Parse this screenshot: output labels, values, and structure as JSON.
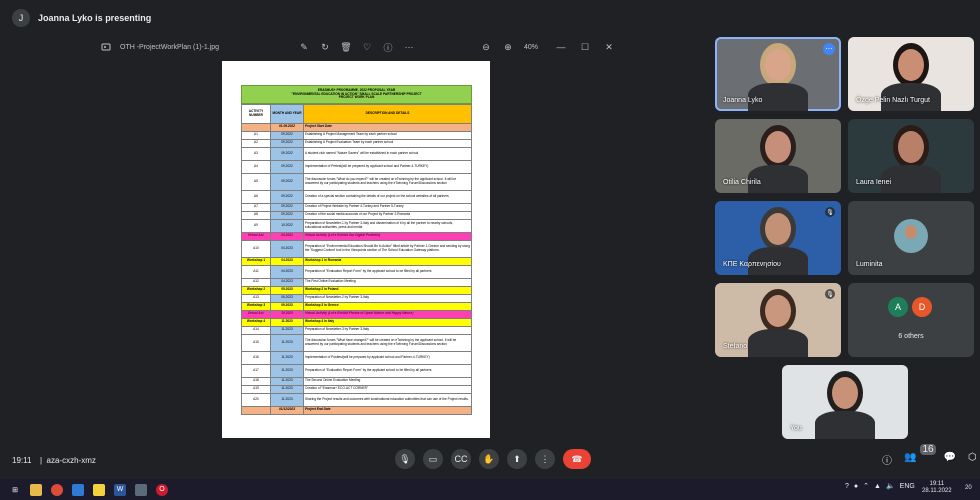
{
  "header": {
    "avatar_letter": "J",
    "presenting_text": "Joanna Lyko is presenting"
  },
  "viewer": {
    "file_name": "OTH -ProjectWorkPlan (1)-1.jpg",
    "zoom_level": "40%",
    "icons": [
      "edit-icon",
      "rotate-icon",
      "delete-icon",
      "favorite-icon",
      "info-icon",
      "more-icon",
      "zoom-out-icon",
      "zoom-in-icon",
      "minimize-icon",
      "maximize-icon",
      "close-icon"
    ]
  },
  "document": {
    "title_lines": [
      "ERASMUS+ PROGRAMME, 2022 PROPOSAL YEAR",
      "\"ENVIRONMENTAL EDUCATION IN ACTION\" SMALL SCALE PARTNERSHIP PROJECT",
      "PROJECT WORK PLAN"
    ],
    "columns": [
      "ACTIVITY NUMBER",
      "MONTH AND YEAR",
      "DESCRIPTION AND DETAILS"
    ],
    "rows": [
      {
        "a": "",
        "m": "01.09.2022",
        "d": "Project Start Date",
        "style": "peach"
      },
      {
        "a": "A1",
        "m": "09.2022",
        "d": "Establishing A Project Management Team by each partner school",
        "style": ""
      },
      {
        "a": "A2",
        "m": "09.2022",
        "d": "Establishing A Project Evaluation Team by each partner school",
        "style": ""
      },
      {
        "a": "A3",
        "m": "09.2022",
        "d": "A student club named \"Nature Savers\" will be established in each partner school",
        "style": "tall"
      },
      {
        "a": "A4",
        "m": "09.2022",
        "d": "Implementation of Pretest(will be prepared by applicant school and Partner-4-TURKEY)",
        "style": "tall"
      },
      {
        "a": "A5",
        "m": "09.2022",
        "d": "The discussion forum-\"What do you expect?\" will be created on eTwinning by the applicant school. It will be answered by our participating students and teachers using the eTwinning Forum/Discussions section",
        "style": "xtall"
      },
      {
        "a": "A6",
        "m": "09.2022",
        "d": "Creation of a special section containing the details of our project on the school websites of all partners",
        "style": "tall"
      },
      {
        "a": "A7",
        "m": "09.2022",
        "d": "Creation of Project Website by Partner 4-Turkey and Partner 5-Turkey",
        "style": ""
      },
      {
        "a": "A8",
        "m": "09.2022",
        "d": "Creation of the social media accounts of our Project by Partner 2-Romania",
        "style": ""
      },
      {
        "a": "A9",
        "m": "10.2022",
        "d": "Preparation of Newsletter-1 by Partner 3-Italy and dissemination of it by all the partner to nearby schools, educational authorities, press and media",
        "style": "tall"
      },
      {
        "a": "Virtual Act.",
        "m": "03.2023",
        "d": "Virtual Activity (Let's Exhibit Our Digital Portfolio)",
        "style": "pink"
      },
      {
        "a": "A10",
        "m": "04.2023",
        "d": "Preparation of \"Environmental Education Should Be in Action\" titled article by Partner 1-Greece and sending by using the 'Suggest Content' tool in the Viewpoints section of The School Education Gateway platform.",
        "style": "xtall"
      },
      {
        "a": "Workshop 1",
        "m": "04.2023",
        "d": "Workshop 1 in Romania",
        "style": "yellow"
      },
      {
        "a": "A11",
        "m": "04.2023",
        "d": "Preparation of \"Evaluation Report Form\" by the applicant school to be filled by all partners",
        "style": "tall"
      },
      {
        "a": "A12",
        "m": "04.2023",
        "d": "The First Online Evaluation Meeting",
        "style": ""
      },
      {
        "a": "Workshop 2",
        "m": "05.2023",
        "d": "Workshop 2 in Poland",
        "style": "yellow"
      },
      {
        "a": "A13",
        "m": "06.2023",
        "d": "Preparation of Newsletter-2 by Partner 3-Italy",
        "style": ""
      },
      {
        "a": "Workshop 3",
        "m": "09.2023",
        "d": "Workshop 3 in Greece",
        "style": "yellow"
      },
      {
        "a": "Virtual Act.",
        "m": "10.2023",
        "d": "Virtual Activity (Let's Exhibit Photos of Upset Nature and Happy Nature)",
        "style": "pink"
      },
      {
        "a": "Workshop 4",
        "m": "11.2023",
        "d": "Workshop 4 in Italy",
        "style": "yellow"
      },
      {
        "a": "A14",
        "m": "11.2023",
        "d": "Preparation of Newsletter-3 by Partner 3-Italy",
        "style": ""
      },
      {
        "a": "A15",
        "m": "11.2023",
        "d": "The discussion forum-\"What have changed?\" will be created on eTwinning by the applicant school. It will be answered by our participating students and teachers using the eTwinning Forum/Discussions section",
        "style": "xtall"
      },
      {
        "a": "A16",
        "m": "11.2023",
        "d": "Implementation of Posttest(will be prepared by applicant school and Partner-4-TURKEY)",
        "style": "tall"
      },
      {
        "a": "A17",
        "m": "11.2023",
        "d": "Preparation of \"Evaluation Report Form\" by the applicant school to be filled by all partners",
        "style": "tall"
      },
      {
        "a": "A18",
        "m": "11.2023",
        "d": "The Second Online Evaluation Meeting",
        "style": ""
      },
      {
        "a": "A19",
        "m": "11.2023",
        "d": "Creation of \"Erasmus+ ECO-ACT CORNER\"",
        "style": ""
      },
      {
        "a": "A20",
        "m": "11.2023",
        "d": "Sharing the Project results and outcomes with local/national education authorities that can use of the Project results.",
        "style": "tall"
      },
      {
        "a": "",
        "m": "01/12/2023",
        "d": "Project End Date",
        "style": "peach"
      }
    ]
  },
  "participants": [
    {
      "name": "Joanna Lyko",
      "bg": "#6b6e73",
      "skin": "#d9a58a",
      "hair": "#c8a77a",
      "highlight": true
    },
    {
      "name": "Özge Pelin Nazlı Turgut",
      "bg": "#e9e4df",
      "skin": "#c98e73",
      "hair": "#1d1513"
    },
    {
      "name": "Otilia Chirila",
      "bg": "#6b6b66",
      "skin": "#c58f7a",
      "hair": "#2a1f1c"
    },
    {
      "name": "Laura Ienei",
      "bg": "#2d3a3d",
      "skin": "#b98069",
      "hair": "#2b1c18"
    },
    {
      "name": "ΚΠΕ Καρπενησίου",
      "bg": "#2c5fa8",
      "skin": "#c39176",
      "hair": "#3c3a38"
    },
    {
      "name": "Luminita",
      "bg": "#3c4043",
      "skin": "#c48b6c",
      "hair": "#2a1e18"
    },
    {
      "name": "Stefano",
      "bg": "#cdbba7",
      "skin": "#c9977d",
      "hair": "#3a2a20"
    },
    {
      "name": "6 others",
      "avatars": [
        "A",
        "D"
      ]
    },
    {
      "name": "You",
      "bg": "#dfe3e6",
      "skin": "#c79277",
      "hair": "#22201f"
    }
  ],
  "bottom": {
    "time": "19:11",
    "meeting_code": "aza-cxzh-xmz",
    "people_count": "16"
  },
  "taskbar": {
    "clock_time": "19:11",
    "clock_date": "28.11.2022",
    "lang": "ENG",
    "notif": "20"
  }
}
